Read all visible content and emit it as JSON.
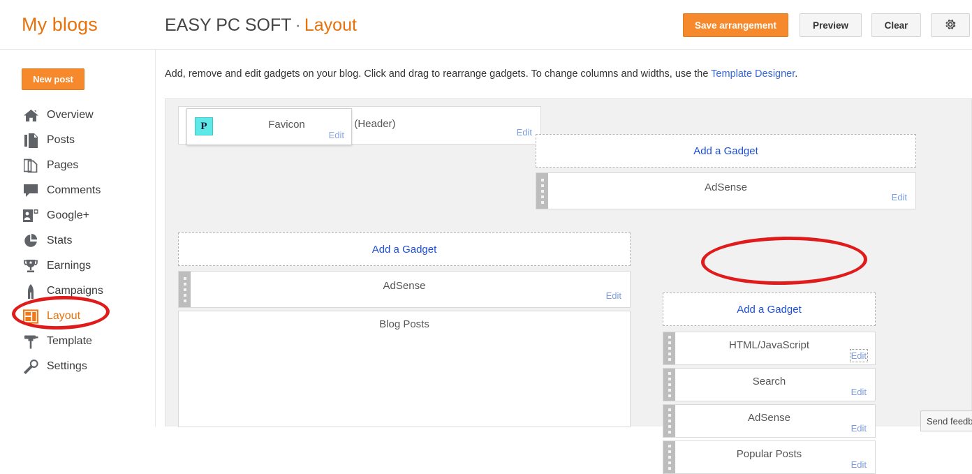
{
  "topbar": {
    "my_blogs": "My blogs",
    "blog_name": "EASY PC SOFT",
    "separator": "·",
    "section": "Layout",
    "save_label": "Save arrangement",
    "preview_label": "Preview",
    "clear_label": "Clear",
    "gear_icon": "gear-icon"
  },
  "sidebar": {
    "new_post_label": "New post",
    "items": [
      {
        "label": "Overview",
        "icon": "home-icon",
        "active": false
      },
      {
        "label": "Posts",
        "icon": "posts-icon",
        "active": false
      },
      {
        "label": "Pages",
        "icon": "pages-icon",
        "active": false
      },
      {
        "label": "Comments",
        "icon": "comment-icon",
        "active": false
      },
      {
        "label": "Google+",
        "icon": "googleplus-icon",
        "active": false
      },
      {
        "label": "Stats",
        "icon": "stats-icon",
        "active": false
      },
      {
        "label": "Earnings",
        "icon": "trophy-icon",
        "active": false
      },
      {
        "label": "Campaigns",
        "icon": "campaigns-icon",
        "active": false
      },
      {
        "label": "Layout",
        "icon": "layout-icon",
        "active": true
      },
      {
        "label": "Template",
        "icon": "template-icon",
        "active": false
      },
      {
        "label": "Settings",
        "icon": "wrench-icon",
        "active": false
      }
    ]
  },
  "main": {
    "description_text": "Add, remove and edit gadgets on your blog. Click and drag to rearrange gadgets. To change columns and widths, use the ",
    "description_link": "Template Designer",
    "description_end": "."
  },
  "layout_canvas": {
    "header_gadget": {
      "title": "SOFT (Header)",
      "edit_label": "Edit"
    },
    "favicon_card": {
      "title": "Favicon",
      "edit_label": "Edit",
      "favicon_glyph": "P"
    },
    "right_top_add": {
      "label": "Add a Gadget"
    },
    "right_top_gadget": {
      "title": "AdSense",
      "edit_label": "Edit"
    },
    "middle_add": {
      "label": "Add a Gadget"
    },
    "middle_gadgets": [
      {
        "title": "AdSense",
        "edit_label": "Edit",
        "draggable": true
      },
      {
        "title": "Blog Posts",
        "edit_label": "",
        "draggable": false
      }
    ],
    "sidebar_add": {
      "label": "Add a Gadget"
    },
    "sidebar_gadgets": [
      {
        "title": "HTML/JavaScript",
        "edit_label": "Edit",
        "focused": true
      },
      {
        "title": "Search",
        "edit_label": "Edit",
        "focused": false
      },
      {
        "title": "AdSense",
        "edit_label": "Edit",
        "focused": false
      },
      {
        "title": "Popular Posts",
        "edit_label": "Edit",
        "focused": false
      }
    ]
  },
  "feedback": {
    "label": "Send feedback"
  },
  "annotations": {
    "color": "#e01b1b",
    "ellipse_layout_target": "Layout",
    "ellipse_addgadget_target": "Add a Gadget"
  },
  "colors": {
    "brand_orange": "#e8710a",
    "button_orange": "#f6892b",
    "link_blue": "#1d4fd8",
    "canvas_grey": "#f1f1f1"
  }
}
